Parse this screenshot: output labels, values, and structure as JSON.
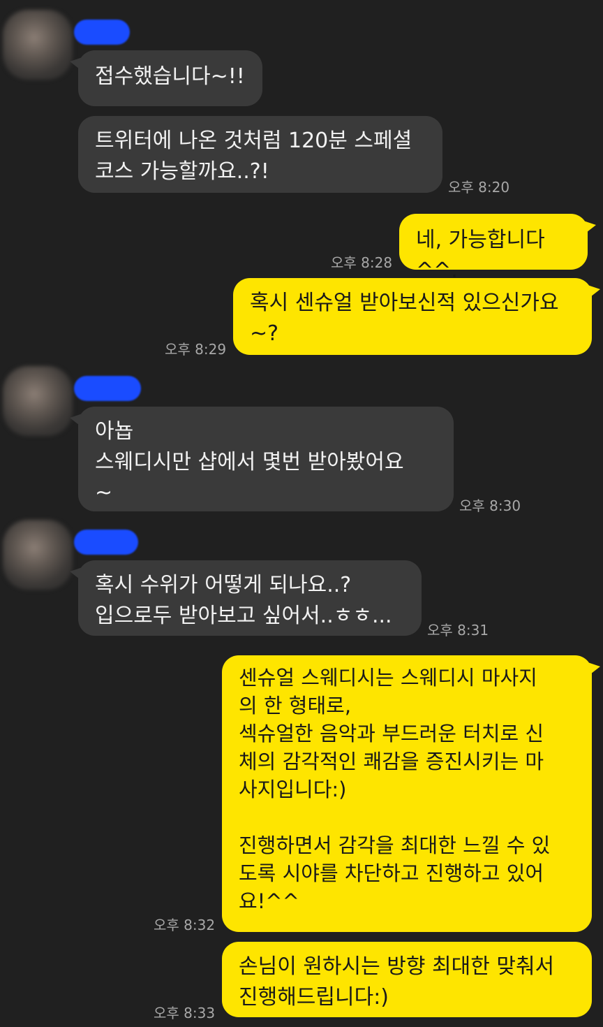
{
  "theme": {
    "background": "#202020",
    "incoming_bubble": "#3a3a3a",
    "outgoing_bubble": "#fee500",
    "redaction": "#1a4cff"
  },
  "messages": [
    {
      "direction": "in",
      "text": "접수했습니다~!!"
    },
    {
      "direction": "in",
      "text": "트위터에 나온 것처럼 120분 스페셜\n코스 가능할까요..?!",
      "time": "오후 8:20"
    },
    {
      "direction": "out",
      "text": "네, 가능합니다^^.",
      "time": "오후 8:28"
    },
    {
      "direction": "out",
      "text": "혹시 센슈얼 받아보신적 있으신가요\n~?",
      "time": "오후 8:29"
    },
    {
      "direction": "in",
      "text": "아뇹\n스웨디시만 샵에서 몇번 받아봤어요\n~",
      "time": "오후 8:30"
    },
    {
      "direction": "in",
      "text": "혹시 수위가 어떻게 되나요..?\n입으로두 받아보고 싶어서..ㅎㅎ...",
      "time": "오후 8:31"
    },
    {
      "direction": "out",
      "text": "센슈얼 스웨디시는 스웨디시 마사지\n의 한 형태로,\n섹슈얼한 음악과 부드러운 터치로 신\n체의 감각적인 쾌감을 증진시키는 마\n사지입니다:)\n\n진행하면서 감각을 최대한 느낄 수 있\n도록 시야를 차단하고 진행하고 있어\n요!^^",
      "time": "오후 8:32"
    },
    {
      "direction": "out",
      "text": "손님이 원하시는 방향 최대한 맞춰서\n진행해드립니다:)",
      "time": "오후 8:33"
    }
  ]
}
